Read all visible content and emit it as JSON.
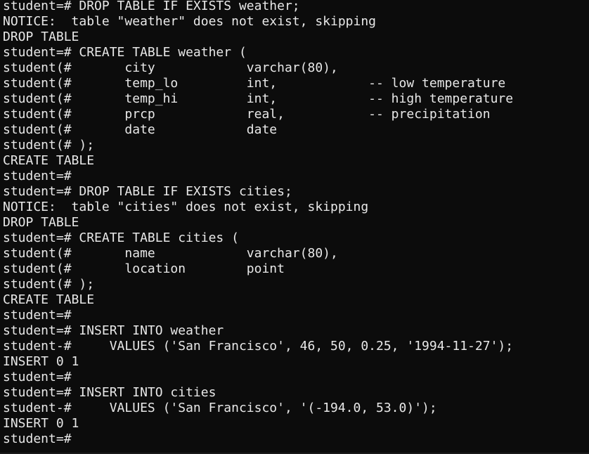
{
  "terminal": {
    "lines": [
      "student=# DROP TABLE IF EXISTS weather;",
      "NOTICE:  table \"weather\" does not exist, skipping",
      "DROP TABLE",
      "student=# CREATE TABLE weather (",
      "student(#       city            varchar(80),",
      "student(#       temp_lo         int,            -- low temperature",
      "student(#       temp_hi         int,            -- high temperature",
      "student(#       prcp            real,           -- precipitation",
      "student(#       date            date",
      "student(# );",
      "CREATE TABLE",
      "student=#",
      "student=# DROP TABLE IF EXISTS cities;",
      "NOTICE:  table \"cities\" does not exist, skipping",
      "DROP TABLE",
      "student=# CREATE TABLE cities (",
      "student(#       name            varchar(80),",
      "student(#       location        point",
      "student(# );",
      "CREATE TABLE",
      "student=#",
      "student=# INSERT INTO weather",
      "student-#     VALUES ('San Francisco', 46, 50, 0.25, '1994-11-27');",
      "INSERT 0 1",
      "student=#",
      "student=# INSERT INTO cities",
      "student-#     VALUES ('San Francisco', '(-194.0, 53.0)');",
      "INSERT 0 1",
      "student=#"
    ]
  },
  "colors": {
    "background": "#0c0c0c",
    "text": "#e8e8e8"
  }
}
